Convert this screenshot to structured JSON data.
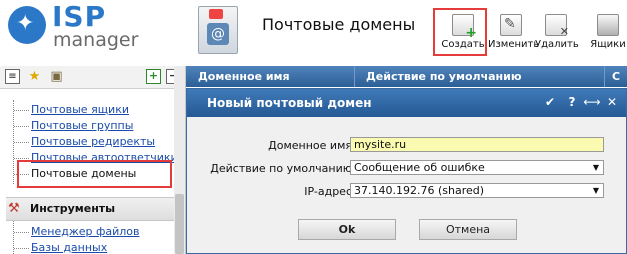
{
  "logo": {
    "line1": "ISP",
    "line2": "manager"
  },
  "header": {
    "page_title": "Почтовые домены",
    "toolbar": [
      {
        "id": "create",
        "label": "Создать",
        "icon": "create-icon"
      },
      {
        "id": "edit",
        "label": "Изменить",
        "icon": "edit-icon"
      },
      {
        "id": "delete",
        "label": "Удалить",
        "icon": "delete-icon"
      },
      {
        "id": "mailboxes",
        "label": "Ящики",
        "icon": "mailbox-icon"
      }
    ]
  },
  "sidebar": {
    "items": [
      {
        "label": "Почтовые ящики"
      },
      {
        "label": "Почтовые группы"
      },
      {
        "label": "Почтовые редиректы"
      },
      {
        "label": "Почтовые автоответчики"
      },
      {
        "label": "Почтовые домены",
        "active": true
      }
    ],
    "section": {
      "label": "Инструменты"
    },
    "tools": [
      {
        "label": "Менеджер файлов"
      },
      {
        "label": "Базы данных"
      }
    ],
    "expand_symbol": "+",
    "collapse_symbol": "−"
  },
  "grid": {
    "columns": [
      "Доменное имя",
      "Действие по умолчанию",
      "С"
    ]
  },
  "dialog": {
    "title": "Новый почтовый домен",
    "fields": {
      "domain": {
        "label": "Доменное имя",
        "value": "mysite.ru"
      },
      "default_action": {
        "label": "Действие по умолчанию",
        "value": "Сообщение об ошибке"
      },
      "ip": {
        "label": "IP-адрес",
        "value": "37.140.192.76 (shared)"
      }
    },
    "ok_label": "Ok",
    "cancel_label": "Отмена",
    "controls": {
      "pin": "✔",
      "help": "?",
      "expand": "⟷",
      "close": "✕"
    }
  },
  "colors": {
    "brand_blue": "#2c78c8",
    "header_blue": "#2d5f97",
    "highlight_red": "#e53b3b",
    "link_blue": "#1a4ba8",
    "input_yellow": "#fafab0"
  }
}
